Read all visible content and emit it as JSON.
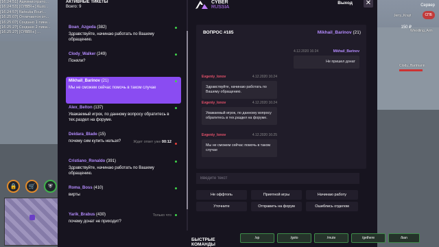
{
  "game": {
    "chat_log": [
      "[16:24:51] Администрато...",
      "[16:24:53] [CYBER+] Kuzo...",
      "[16:24:57] Natsuka Ecuri...",
      "[16:25:07] Отличается от...",
      "[16:25:07] Создано 1 пике...",
      "[16:25:27] Создано 2 пике...",
      "[16:25:27] [CYBER+] ..."
    ],
    "hud_icons": [
      "lock-icon",
      "shop-icon",
      "shield-icon"
    ],
    "hud_time": "Сервер",
    "hud_badge": "СПБ",
    "hud_money": "150 ₽",
    "players": [
      {
        "name": "Jerry_Krayt"
      },
      {
        "name": "Wrestling_Arm"
      },
      {
        "name": "Clody_Hartmann"
      }
    ]
  },
  "tickets": {
    "header": "АКТИВНЫЕ ТИКЕТЫ",
    "total_label": "Всего: 9",
    "items": [
      {
        "user": "Boan_Azgeda",
        "count": "(382)",
        "msg": "Здравствуйте, начинаю работать по Вашему обращению.",
        "user_color": "#b58cff",
        "status": "green",
        "wait": "",
        "wait_time": ""
      },
      {
        "user": "Clody_Walker",
        "count": "(249)",
        "msg": "Поняли?",
        "user_color": "#b58cff",
        "status": "green",
        "wait": "",
        "wait_time": ""
      },
      {
        "user": "Mikhail_Barinov",
        "count": "(21)",
        "msg": "Мы не сможем сейчас помочь в таком случае",
        "user_color": "#ffffff",
        "status": "green",
        "wait": "",
        "wait_time": "",
        "active": true
      },
      {
        "user": "Alex_Belton",
        "count": "(137)",
        "msg": "Уважаемый игрок, по данному вопросу обратитесь в тех.раздел на форуме.",
        "user_color": "#b58cff",
        "status": "green",
        "wait": "",
        "wait_time": ""
      },
      {
        "user": "Deidara_Blade",
        "count": "(15)",
        "msg": "почему сим купить нельзя?",
        "user_color": "#b58cff",
        "status": "red",
        "wait": "Ждет ответ уже",
        "wait_time": "00:12"
      },
      {
        "user": "Cristiano_Ronaldo",
        "count": "(391)",
        "msg": "Здравствуйте, начинаю работать по Вашему обращению.",
        "user_color": "#b58cff",
        "status": "green",
        "wait": "",
        "wait_time": ""
      },
      {
        "user": "Roma_Boss",
        "count": "(410)",
        "msg": "вирты",
        "user_color": "#b58cff",
        "status": "green",
        "wait": "",
        "wait_time": ""
      },
      {
        "user": "Yarik_Brabus",
        "count": "(430)",
        "msg": "почему донат не приходит?",
        "user_color": "#b58cff",
        "status": "green",
        "wait": "Только что",
        "wait_time": ""
      }
    ]
  },
  "header": {
    "logo_line1": "CYBER",
    "logo_line2": "RUSSIA",
    "exit_label": "Выход",
    "close_label": "✕"
  },
  "chat": {
    "question_title": "ВОПРОС #185",
    "question_user": "Mikhail_Barinov",
    "question_user_count": "(21)",
    "messages": [
      {
        "author": "Mikhail_Barinov",
        "time": "4.12.2020 16:24",
        "text": "Не пришел донат",
        "side": "right"
      },
      {
        "author": "Evgeniy_Ionov",
        "time": "4.12.2020 16:24",
        "text": "Здравствуйте, начинаю работать по Вашему обращению.",
        "side": "left"
      },
      {
        "author": "Evgeniy_Ionov",
        "time": "4.12.2020 16:24",
        "text": "Уважаемый игрок, по данному вопросу обратитесь в тех.раздел на форуме.",
        "side": "left"
      },
      {
        "author": "Evgeniy_Ionov",
        "time": "4.12.2020 16:25",
        "text": "Мы не сможем сейчас помочь в таком случае",
        "side": "left"
      }
    ],
    "input_placeholder": "Введите текст",
    "quick_replies": [
      "Не оффтопь",
      "Приятной игры",
      "Начинаю работу",
      "Уточните",
      "Отправить на форум",
      "Ошиблись отделом"
    ]
  },
  "commands": {
    "label_line1": "БЫСТРЫЕ",
    "label_line2": "КОМАНДЫ",
    "buttons": [
      "/sp",
      "/goto",
      "/mute",
      "/gethere",
      "/ban"
    ]
  },
  "colors": {
    "panel_bg": "#17141f",
    "accent_purple": "#8a4cf2",
    "author_red": "#e8526b",
    "status_green": "#3fd44a",
    "status_red": "#e3403b"
  }
}
